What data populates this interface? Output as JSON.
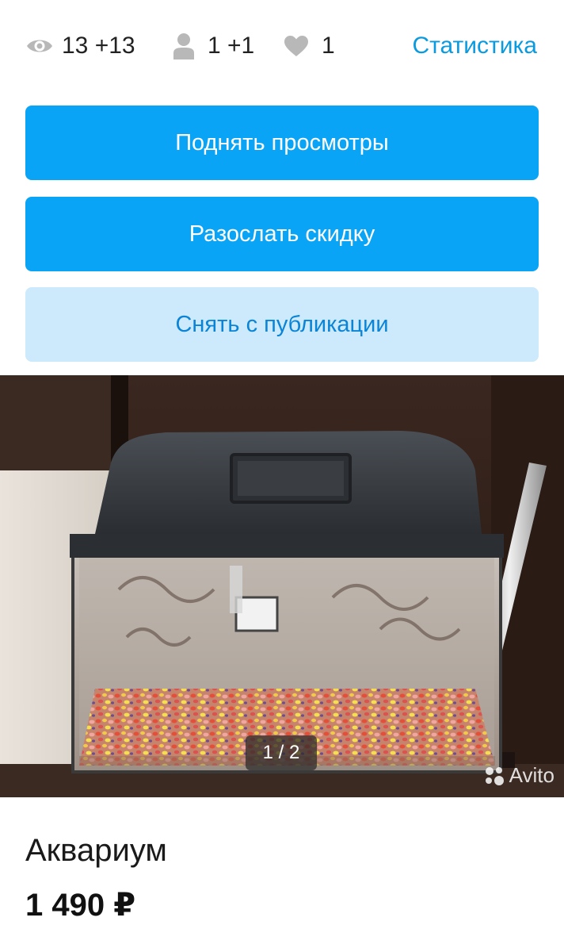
{
  "stats": {
    "views": "13 +13",
    "contacts": "1 +1",
    "favorites": "1",
    "statistics_link": "Статистика"
  },
  "actions": {
    "raise_views": "Поднять просмотры",
    "send_discount": "Разослать скидку",
    "unpublish": "Снять с публикации"
  },
  "gallery": {
    "counter": "1 / 2",
    "watermark": "Avito"
  },
  "listing": {
    "title": "Аквариум",
    "price": "1 490 ₽"
  },
  "colors": {
    "accent": "#0aa4f6",
    "link": "#0a9ae0",
    "soft_button": "#cdeafd"
  }
}
